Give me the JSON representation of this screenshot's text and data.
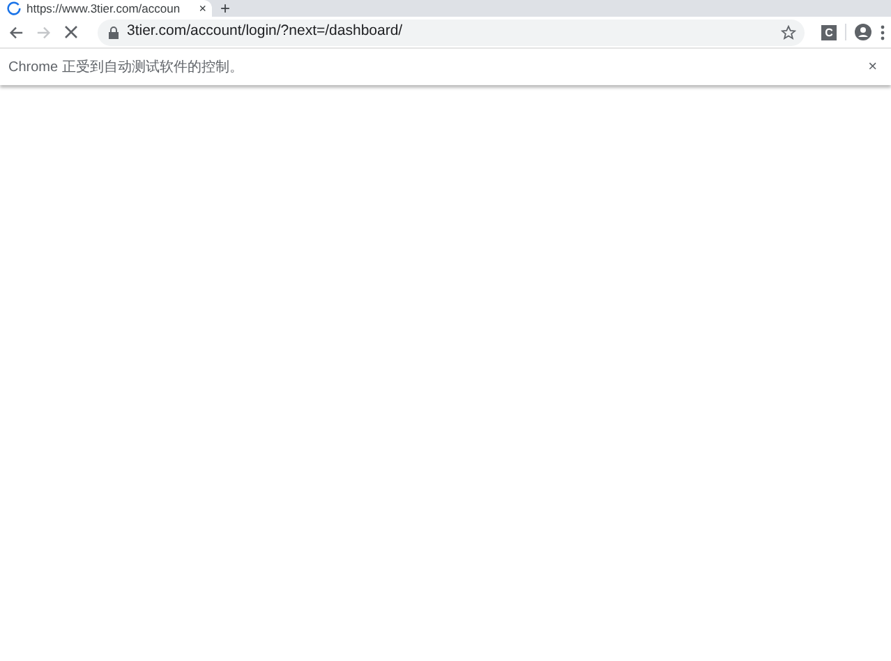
{
  "tab": {
    "title": "https://www.3tier.com/accoun",
    "close": "×",
    "loading": true
  },
  "new_tab": "+",
  "toolbar": {
    "url": "3tier.com/account/login/?next=/dashboard/",
    "forward_disabled": true,
    "extension_label": "C"
  },
  "infobar": {
    "message": "Chrome 正受到自动测试软件的控制。",
    "close": "×"
  }
}
